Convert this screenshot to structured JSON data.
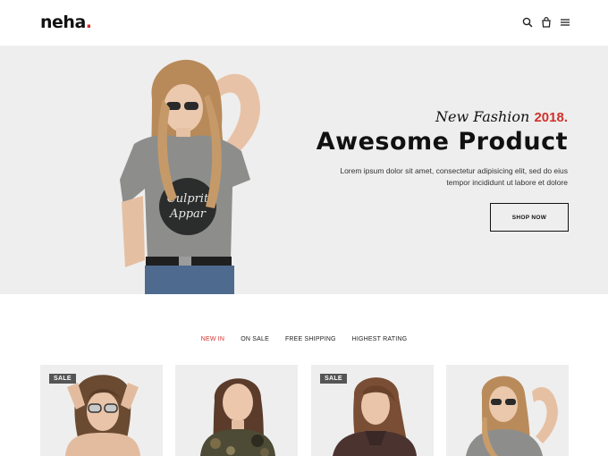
{
  "brand": {
    "name": "neha",
    "dot": "."
  },
  "header": {
    "icons": [
      "search-icon",
      "bag-icon",
      "menu-icon"
    ]
  },
  "hero": {
    "subtitle": "New Fashion",
    "year": "2018.",
    "title": "Awesome Product",
    "description_line1": "Lorem ipsum dolor sit amet, consectetur adipisicing elit, sed do eius",
    "description_line2": "tempor incididunt ut labore et dolore",
    "shop_label": "SHOP NOW",
    "tshirt_text_line1": "Culprit",
    "tshirt_text_line2": "Appar"
  },
  "tabs": [
    {
      "label": "NEW IN",
      "active": true
    },
    {
      "label": "ON SALE",
      "active": false
    },
    {
      "label": "FREE SHIPPING",
      "active": false
    },
    {
      "label": "HIGHEST RATING",
      "active": false
    }
  ],
  "products": [
    {
      "badge": "SALE"
    },
    {
      "badge": ""
    },
    {
      "badge": "SALE"
    },
    {
      "badge": ""
    }
  ],
  "colors": {
    "accent": "#d0312d",
    "hero_bg": "#eeeeee",
    "badge_bg": "#555555"
  }
}
